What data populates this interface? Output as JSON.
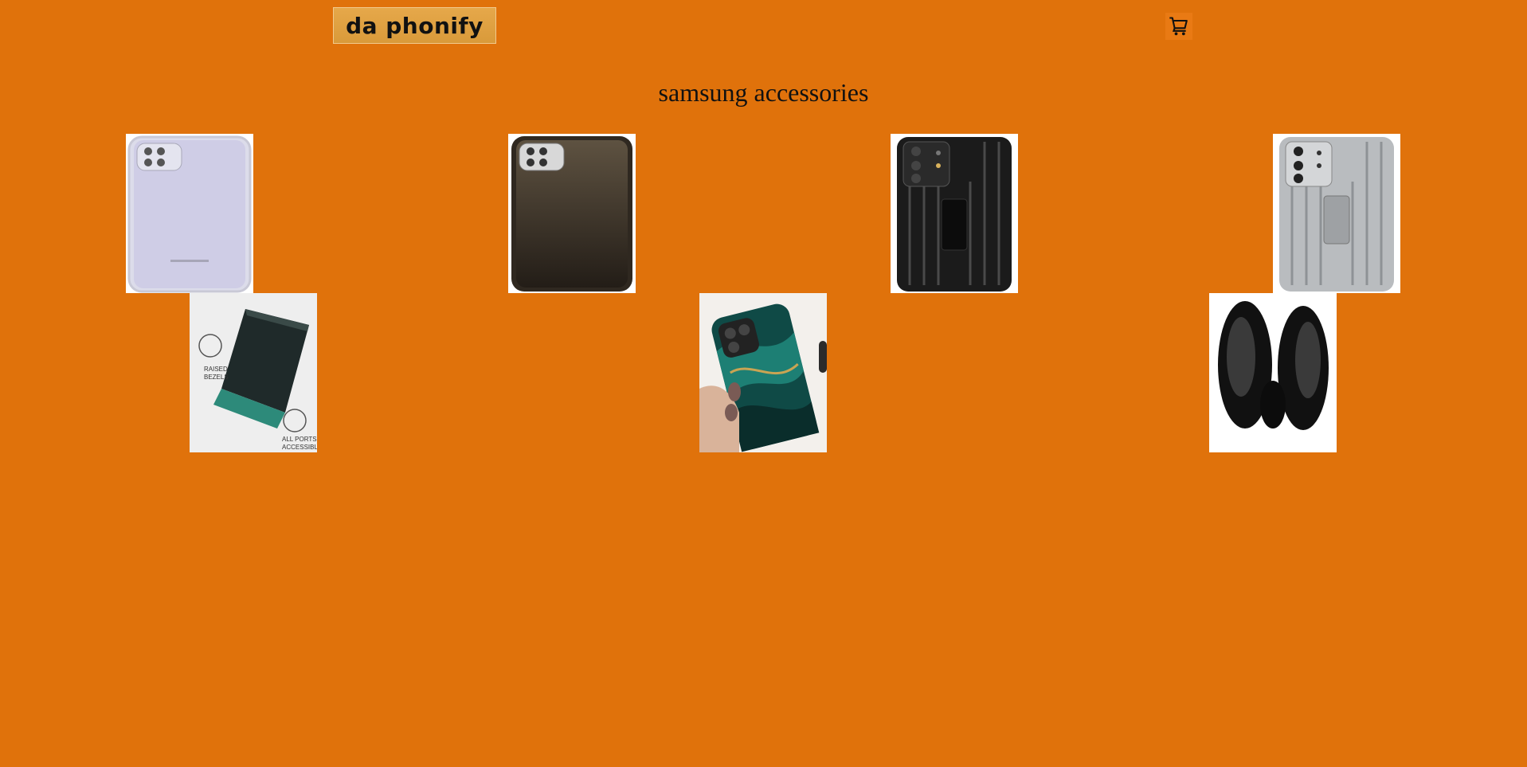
{
  "header": {
    "logo_text": "da phonify",
    "cart_icon": "cart-icon"
  },
  "page": {
    "title": "samsung accessories"
  },
  "products": [
    {
      "name": "clear lavender case",
      "icon": "phone-case-clear-image"
    },
    {
      "name": "brown translucent case",
      "icon": "phone-case-brown-image"
    },
    {
      "name": "black rugged standing case",
      "icon": "phone-case-black-stand-image"
    },
    {
      "name": "silver rugged standing case",
      "icon": "phone-case-silver-stand-image"
    },
    {
      "name": "flip phone case",
      "icon": "flip-case-image",
      "labels": [
        "RAISED",
        "BEZELS",
        "ALL PORTS",
        "ACCESSIBLE"
      ]
    },
    {
      "name": "teal marble case",
      "icon": "marble-case-image"
    },
    {
      "name": "black earbuds",
      "icon": "earbuds-image"
    }
  ],
  "colors": {
    "background": "#e0720b",
    "logo_bg": "#dba045",
    "text": "#111111"
  }
}
